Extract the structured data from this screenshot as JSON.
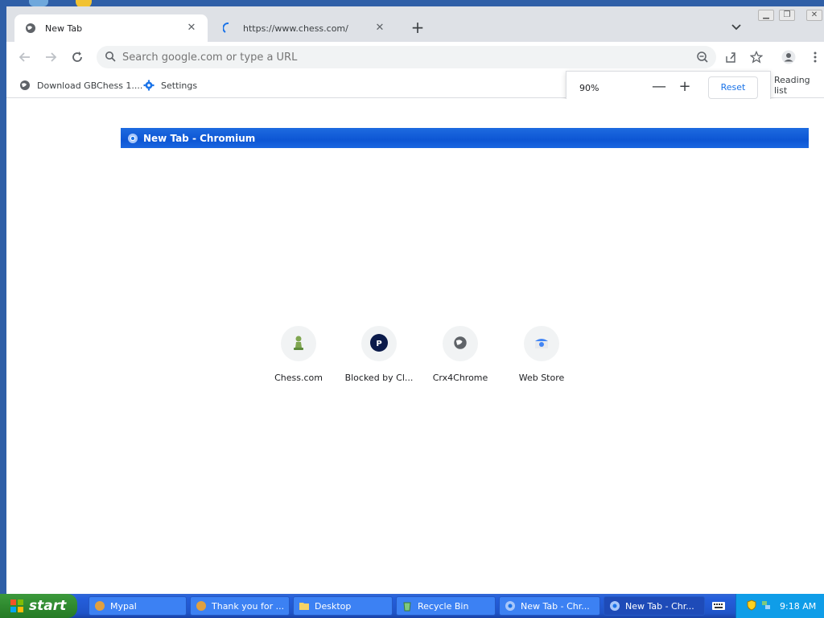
{
  "browser": {
    "tabs": [
      {
        "label": "New Tab",
        "active": true
      },
      {
        "label": "https://www.chess.com/",
        "active": false,
        "loading": true
      }
    ],
    "omnibox": {
      "placeholder": "Search google.com or type a URL"
    },
    "bookmarks": [
      {
        "label": "Download GBChess 1....",
        "icon": "globe-icon"
      },
      {
        "label": "Settings",
        "icon": "gear-icon"
      }
    ],
    "reading_list": "Reading list",
    "zoom": {
      "level": "90%",
      "reset_label": "Reset"
    }
  },
  "page": {
    "title_bar": "New Tab - Chromium",
    "shortcuts": [
      {
        "label": "Chess.com",
        "icon": "chess-pawn-icon"
      },
      {
        "label": "Blocked by Cl...",
        "icon": "p-letter-icon"
      },
      {
        "label": "Crx4Chrome",
        "icon": "globe-icon"
      },
      {
        "label": "Web Store",
        "icon": "webstore-icon"
      }
    ]
  },
  "taskbar": {
    "start_label": "start",
    "tasks": [
      {
        "label": "Mypal"
      },
      {
        "label": "Thank you for ..."
      },
      {
        "label": "Desktop"
      },
      {
        "label": "Recycle Bin"
      },
      {
        "label": "New Tab - Chr..."
      },
      {
        "label": "New Tab - Chr...",
        "active": true
      }
    ],
    "clock": "9:18 AM"
  },
  "colors": {
    "title_bar": "#0d56d4",
    "taskbar": "#245edb",
    "start_button": "#2f8a2f",
    "tray": "#0f9de8"
  }
}
